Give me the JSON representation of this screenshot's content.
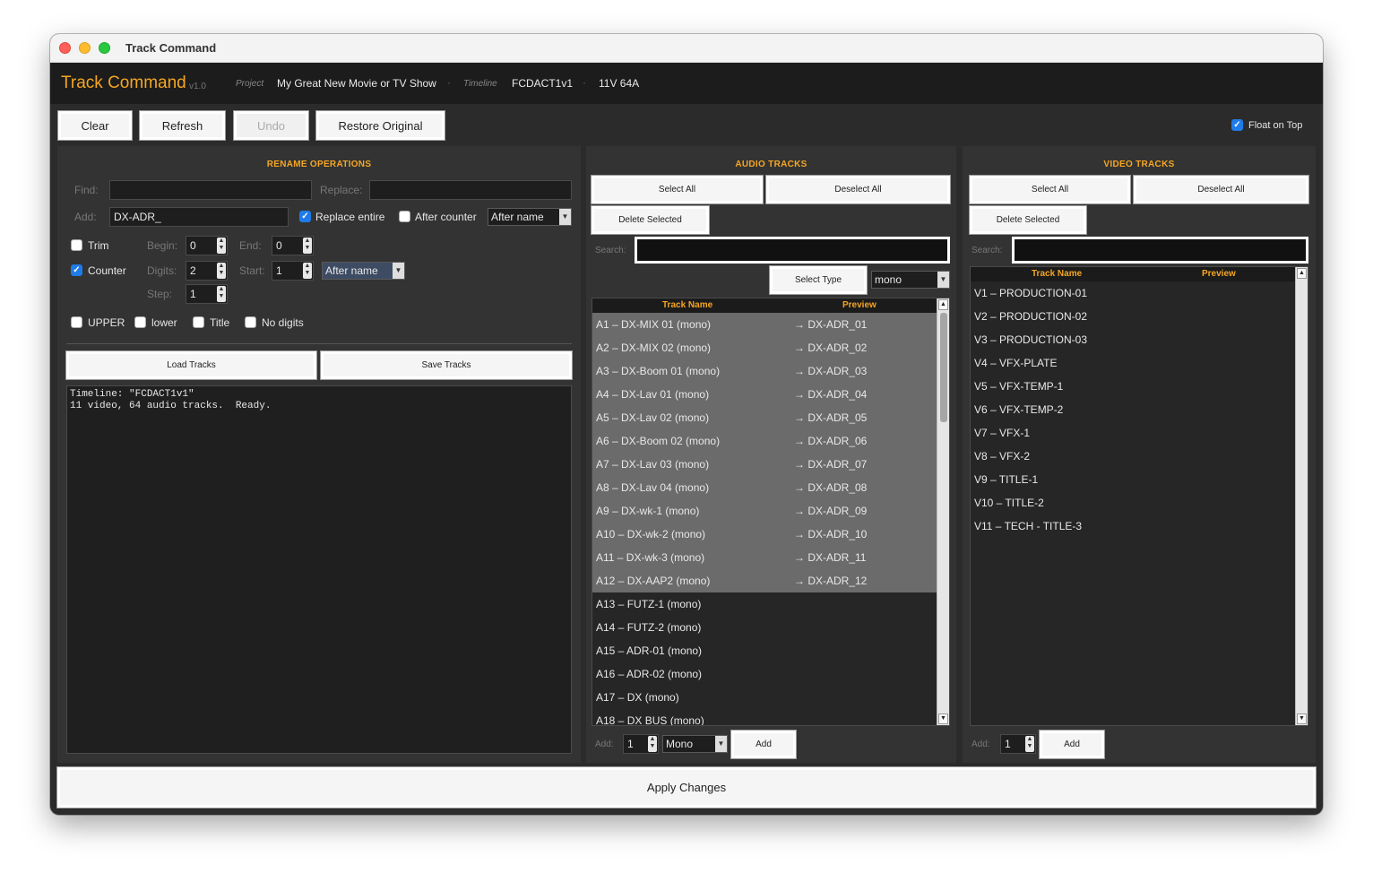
{
  "window": {
    "title": "Track Command"
  },
  "header": {
    "app_name": "Track Command",
    "version": "v1.0",
    "project_label": "Project",
    "project_value": "My Great New Movie or TV Show",
    "timeline_label": "Timeline",
    "timeline_value": "FCDACT1v1",
    "track_counts": "11V  64A",
    "separator": "·"
  },
  "toolbar": {
    "clear": "Clear",
    "refresh": "Refresh",
    "undo": "Undo",
    "restore": "Restore Original",
    "float_on_top": "Float on Top"
  },
  "rename": {
    "title": "RENAME OPERATIONS",
    "find_label": "Find:",
    "find_value": "",
    "replace_label": "Replace:",
    "replace_value": "",
    "add_label": "Add:",
    "add_value": "DX-ADR_",
    "replace_entire_label": "Replace entire",
    "replace_entire_checked": true,
    "after_counter_label": "After counter",
    "after_counter_checked": false,
    "add_position": "After name",
    "trim_label": "Trim",
    "trim_checked": false,
    "begin_label": "Begin:",
    "begin_value": "0",
    "end_label": "End:",
    "end_value": "0",
    "counter_label": "Counter",
    "counter_checked": true,
    "digits_label": "Digits:",
    "digits_value": "2",
    "start_label": "Start:",
    "start_value": "1",
    "counter_position": "After name",
    "step_label": "Step:",
    "step_value": "1",
    "upper_label": "UPPER",
    "lower_label": "lower",
    "title_label": "Title",
    "nodigits_label": "No digits",
    "load_tracks": "Load Tracks",
    "save_tracks": "Save Tracks",
    "console_text": "Timeline: \"FCDACT1v1\"\n11 video, 64 audio tracks.  Ready."
  },
  "audio": {
    "title": "AUDIO TRACKS",
    "select_all": "Select All",
    "deselect_all": "Deselect All",
    "delete_selected": "Delete Selected",
    "search_label": "Search:",
    "search_value": "",
    "select_type": "Select Type",
    "type_value": "mono",
    "col_name": "Track Name",
    "col_preview": "Preview",
    "tracks": [
      {
        "name": "A1 – DX-MIX 01  (mono)",
        "preview": "→ DX-ADR_01",
        "selected": true
      },
      {
        "name": "A2 – DX-MIX 02  (mono)",
        "preview": "→ DX-ADR_02",
        "selected": true
      },
      {
        "name": "A3 – DX-Boom 01  (mono)",
        "preview": "→ DX-ADR_03",
        "selected": true
      },
      {
        "name": "A4 – DX-Lav 01  (mono)",
        "preview": "→ DX-ADR_04",
        "selected": true
      },
      {
        "name": "A5 – DX-Lav 02  (mono)",
        "preview": "→ DX-ADR_05",
        "selected": true
      },
      {
        "name": "A6 – DX-Boom 02  (mono)",
        "preview": "→ DX-ADR_06",
        "selected": true
      },
      {
        "name": "A7 – DX-Lav 03  (mono)",
        "preview": "→ DX-ADR_07",
        "selected": true
      },
      {
        "name": "A8 – DX-Lav 04  (mono)",
        "preview": "→ DX-ADR_08",
        "selected": true
      },
      {
        "name": "A9 – DX-wk-1  (mono)",
        "preview": "→ DX-ADR_09",
        "selected": true
      },
      {
        "name": "A10 – DX-wk-2  (mono)",
        "preview": "→ DX-ADR_10",
        "selected": true
      },
      {
        "name": "A11 – DX-wk-3  (mono)",
        "preview": "→ DX-ADR_11",
        "selected": true
      },
      {
        "name": "A12 – DX-AAP2  (mono)",
        "preview": "→ DX-ADR_12",
        "selected": true
      },
      {
        "name": "A13 – FUTZ-1  (mono)",
        "preview": "",
        "selected": false
      },
      {
        "name": "A14 – FUTZ-2  (mono)",
        "preview": "",
        "selected": false
      },
      {
        "name": "A15 – ADR-01  (mono)",
        "preview": "",
        "selected": false
      },
      {
        "name": "A16 – ADR-02  (mono)",
        "preview": "",
        "selected": false
      },
      {
        "name": "A17 – DX  (mono)",
        "preview": "",
        "selected": false
      },
      {
        "name": "A18 – DX BUS  (mono)",
        "preview": "",
        "selected": false
      }
    ],
    "add_label": "Add:",
    "add_count": "1",
    "add_type": "Mono",
    "add_button": "Add"
  },
  "video": {
    "title": "VIDEO TRACKS",
    "select_all": "Select All",
    "deselect_all": "Deselect All",
    "delete_selected": "Delete Selected",
    "search_label": "Search:",
    "search_value": "",
    "col_name": "Track Name",
    "col_preview": "Preview",
    "tracks": [
      {
        "name": "V1 – PRODUCTION-01"
      },
      {
        "name": "V2 – PRODUCTION-02"
      },
      {
        "name": "V3 – PRODUCTION-03"
      },
      {
        "name": "V4 – VFX-PLATE"
      },
      {
        "name": "V5 – VFX-TEMP-1"
      },
      {
        "name": "V6 – VFX-TEMP-2"
      },
      {
        "name": "V7 – VFX-1"
      },
      {
        "name": "V8 – VFX-2"
      },
      {
        "name": "V9 – TITLE-1"
      },
      {
        "name": "V10 – TITLE-2"
      },
      {
        "name": "V11 – TECH - TITLE-3"
      }
    ],
    "add_label": "Add:",
    "add_count": "1",
    "add_button": "Add"
  },
  "footer": {
    "apply": "Apply Changes"
  },
  "colors": {
    "accent": "#f5a623",
    "background": "#2b2b2b",
    "panel": "#333333",
    "selected_row": "#6b6b6b",
    "checkbox_on": "#1f7be8"
  }
}
